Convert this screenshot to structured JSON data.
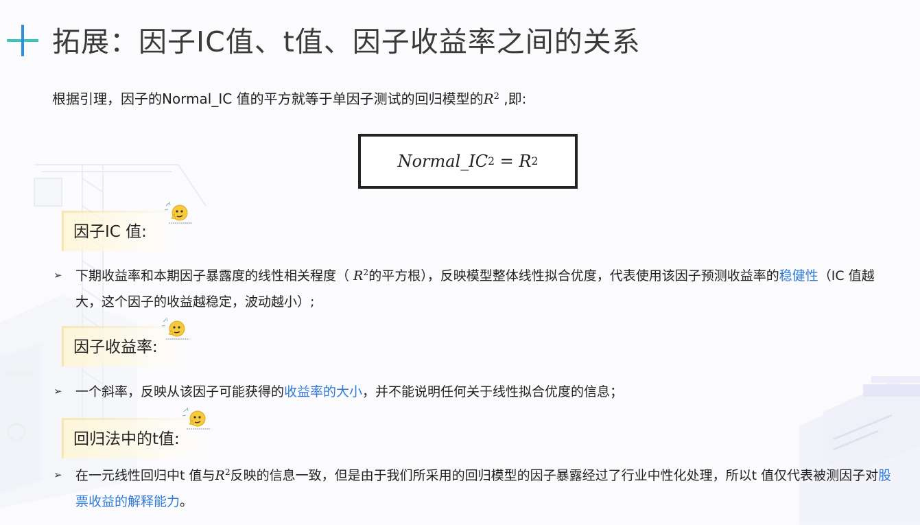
{
  "title": "拓展：因子IC值、t值、因子收益率之间的关系",
  "intro": {
    "text": "根据引理，因子的Normal_IC 值的平方就等于单因子测试的回归模型的",
    "r": "R",
    "exp": "2",
    "tail": " ,即:"
  },
  "formula": {
    "lhs": "Normal_IC",
    "lhs_exp": "2",
    "eq": " = ",
    "rhs": "R",
    "rhs_exp": "2"
  },
  "sections": [
    {
      "label": "因子IC 值:",
      "bullet_parts": [
        "下期收益率和本期因子暴露度的线性相关程度（ ",
        "R",
        "2",
        "的平方根），反映模型整体线性拟合优度，代表使用该因子预测收益率的",
        "稳健性",
        "（IC 值越大，这个因子的收益越稳定，波动越小）;"
      ]
    },
    {
      "label": "因子收益率:",
      "bullet_parts": [
        "一个斜率，反映从该因子可能获得的",
        "收益率的大小",
        "，并不能说明任何关于线性拟合优度的信息；"
      ]
    },
    {
      "label": "回归法中的t值:",
      "bullet_parts": [
        "在一元线性回归中t 值与",
        "R",
        "2",
        "反映的信息一致，但是由于我们所采用的回归模型的因子暴露经过了行业中性化处理，所以t 值仅代表被测因子对",
        "股票收益的解释能力",
        "。"
      ]
    }
  ],
  "bullet_marker": "➢",
  "colors": {
    "title": "#3a3a3a",
    "highlight": "#2f7ad8",
    "plus_blue": "#2f8fe0",
    "plus_green": "#3cc7b8"
  },
  "icons": {
    "header": "plus-icon",
    "section": "thinking-emoji-icon",
    "decor": "building-illustration"
  }
}
